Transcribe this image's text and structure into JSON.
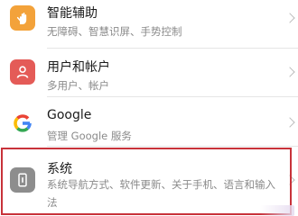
{
  "colors": {
    "accessibility_icon_bg": "#f3a23a",
    "users_icon_bg": "#e45b57",
    "google_icon_bg": "#ffffff",
    "system_icon_bg": "#8d8d8d",
    "highlight_border": "#c8323a",
    "title_text": "#1a1a1a",
    "subtitle_text": "#8a8a8a"
  },
  "settings": {
    "items": [
      {
        "title": "智能辅助",
        "subtitle": "无障碍、智慧识屏、手势控制",
        "icon": "hand-icon"
      },
      {
        "title": "用户和帐户",
        "subtitle": "多用户、帐户",
        "icon": "user-icon"
      },
      {
        "title": "Google",
        "subtitle": "管理 Google 服务",
        "icon": "google-icon"
      },
      {
        "title": "系统",
        "subtitle": "系统导航方式、软件更新、关于手机、语言和输入法",
        "icon": "phone-icon"
      }
    ]
  }
}
